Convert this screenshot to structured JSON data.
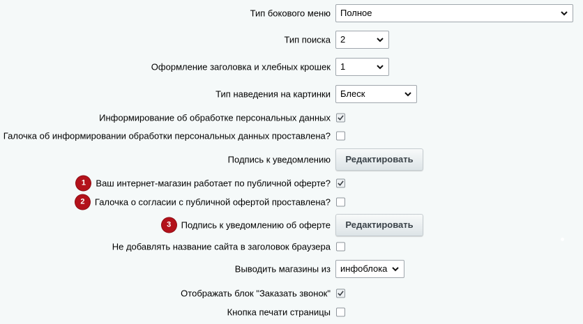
{
  "settings": {
    "sidebar_menu_type": {
      "label": "Тип бокового меню",
      "value": "Полное"
    },
    "search_type": {
      "label": "Тип поиска",
      "value": "2"
    },
    "header_breadcrumbs_style": {
      "label": "Оформление заголовка и хлебных крошек",
      "value": "1"
    },
    "image_hover_type": {
      "label": "Тип наведения на картинки",
      "value": "Блеск"
    },
    "personal_data_notice": {
      "label": "Информирование об обработке персональных данных",
      "checked": true
    },
    "personal_data_checkbox_default": {
      "label": "Галочка об информировании обработки персональных данных проставлена?",
      "checked": false
    },
    "notification_caption": {
      "label": "Подпись к уведомлению",
      "button": "Редактировать"
    },
    "public_offer": {
      "badge": "1",
      "label": "Ваш интернет-магазин работает по публичной оферте?",
      "checked": true
    },
    "public_offer_checkbox_default": {
      "badge": "2",
      "label": "Галочка о согласии с публичной офертой проставлена?",
      "checked": false
    },
    "offer_notification_caption": {
      "badge": "3",
      "label": "Подпись к уведомлению об оферте",
      "button": "Редактировать"
    },
    "no_site_name_in_title": {
      "label": "Не добавлять название сайта в заголовок браузера",
      "checked": false
    },
    "stores_source": {
      "label": "Выводить магазины из",
      "value": "инфоблока"
    },
    "callback_block": {
      "label": "Отображать блок \"Заказать звонок\"",
      "checked": true
    },
    "print_button": {
      "label": "Кнопка печати страницы",
      "checked": false
    }
  }
}
